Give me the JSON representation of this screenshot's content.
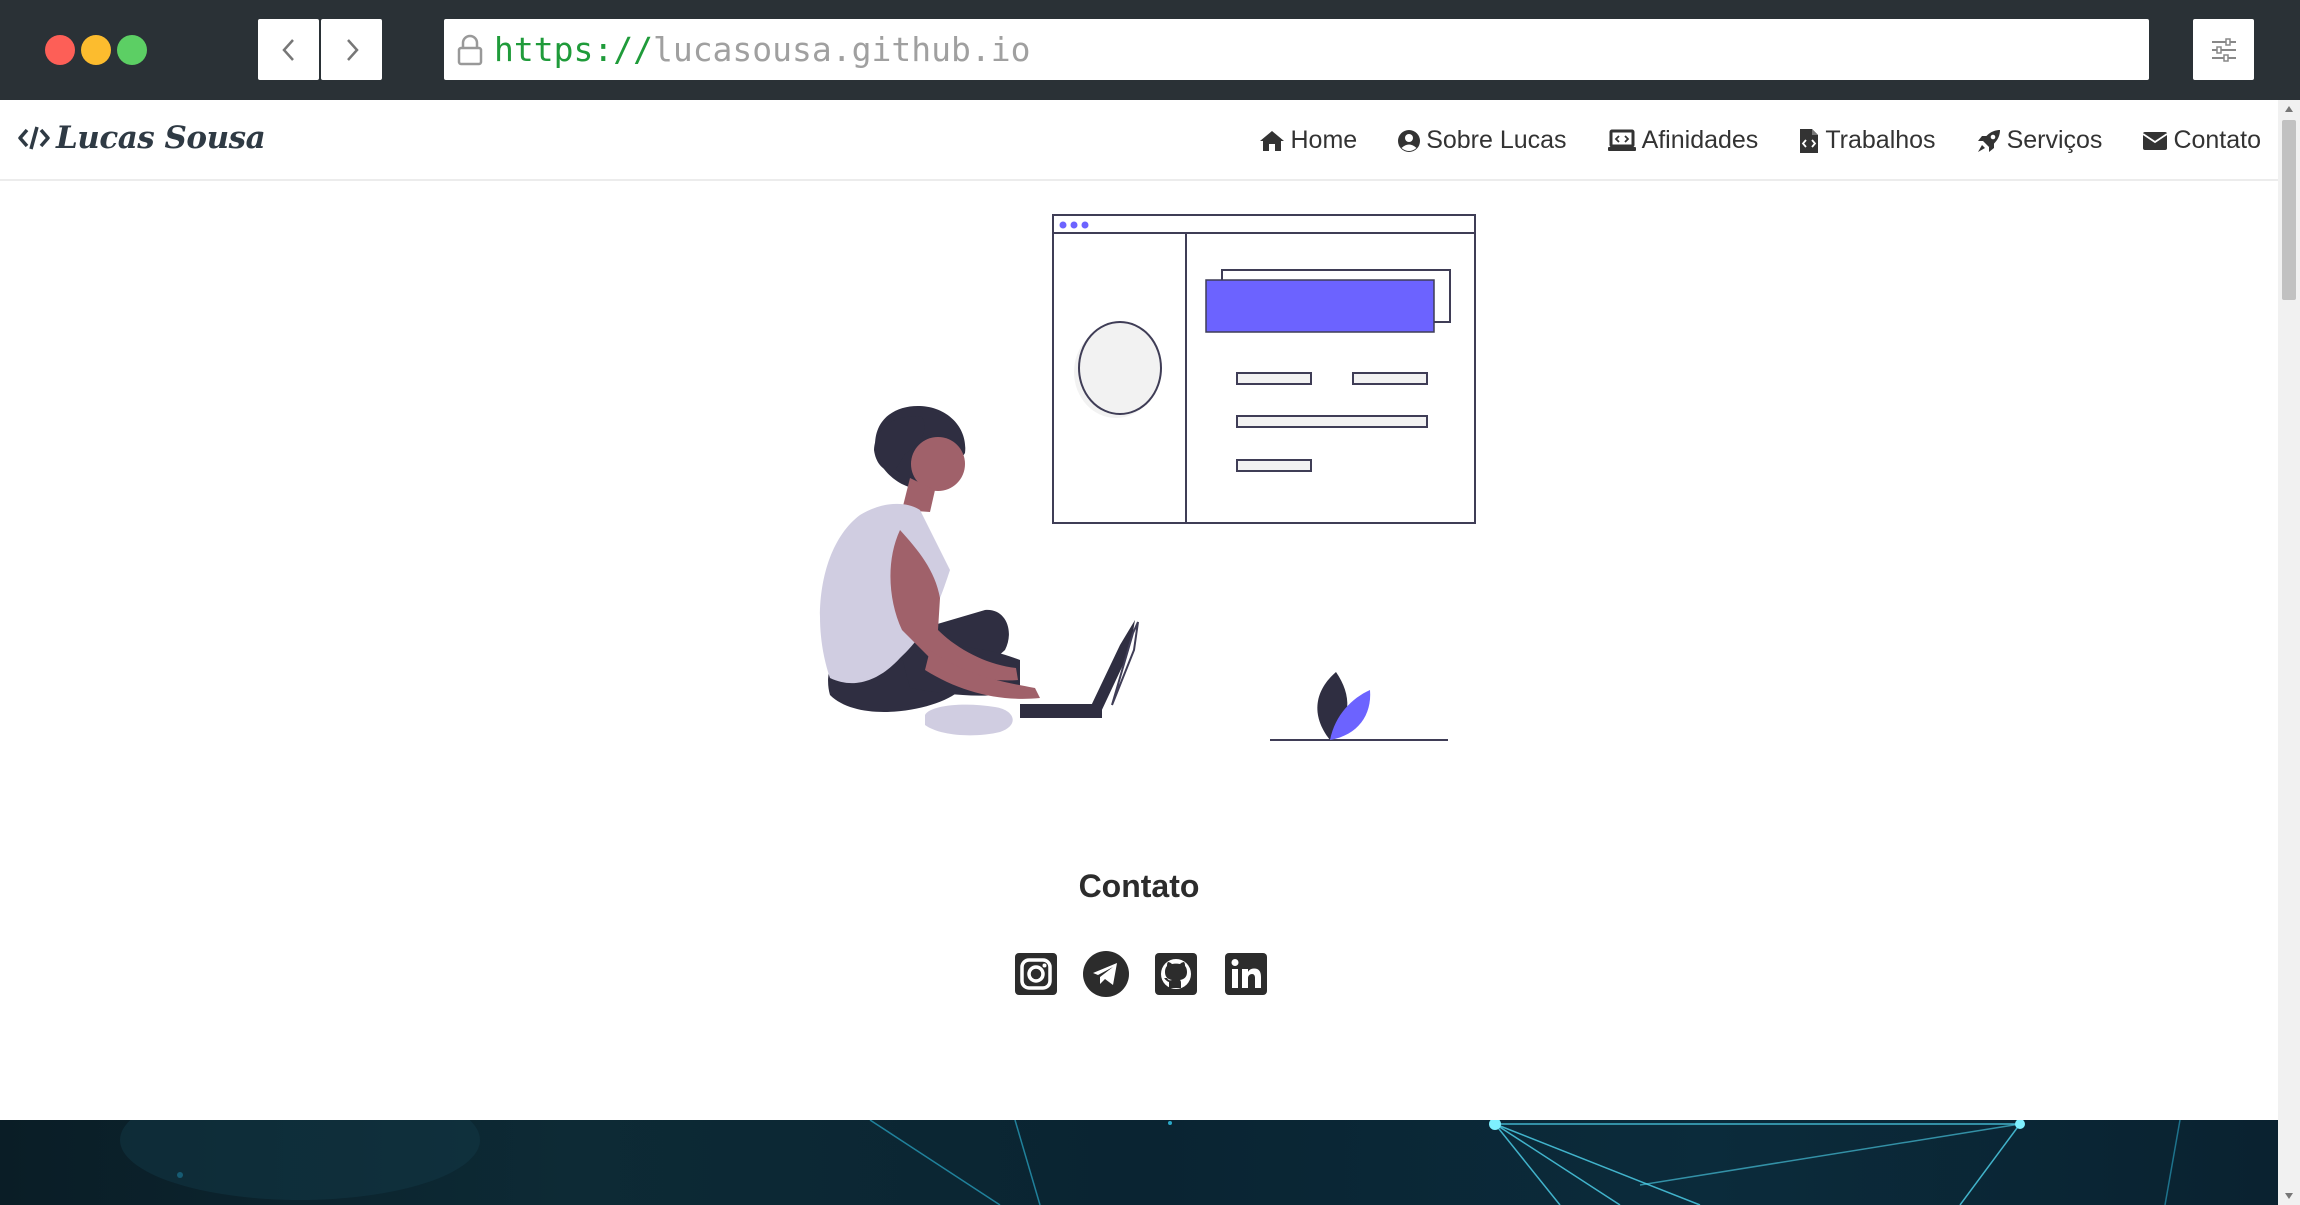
{
  "browser": {
    "url_scheme": "https://",
    "url_host": "lucasousa.github.io",
    "icons": [
      "back-arrow-icon",
      "forward-arrow-icon",
      "lock-icon",
      "sliders-icon"
    ]
  },
  "site": {
    "brand": "Lucas Sousa",
    "nav": [
      {
        "label": "Home",
        "icon": "home-icon"
      },
      {
        "label": "Sobre Lucas",
        "icon": "user-circle-icon"
      },
      {
        "label": "Afinidades",
        "icon": "laptop-code-icon"
      },
      {
        "label": "Trabalhos",
        "icon": "file-code-icon"
      },
      {
        "label": "Serviços",
        "icon": "rocket-icon"
      },
      {
        "label": "Contato",
        "icon": "envelope-icon"
      }
    ]
  },
  "contact": {
    "title": "Contato",
    "social": [
      "instagram-icon",
      "telegram-icon",
      "github-icon",
      "linkedin-icon"
    ]
  },
  "colors": {
    "chrome_bg": "#2a3136",
    "accent": "#6c63ff",
    "text_dark": "#2f2e41",
    "shirt": "#d0cde1",
    "skin": "#a0616a"
  }
}
